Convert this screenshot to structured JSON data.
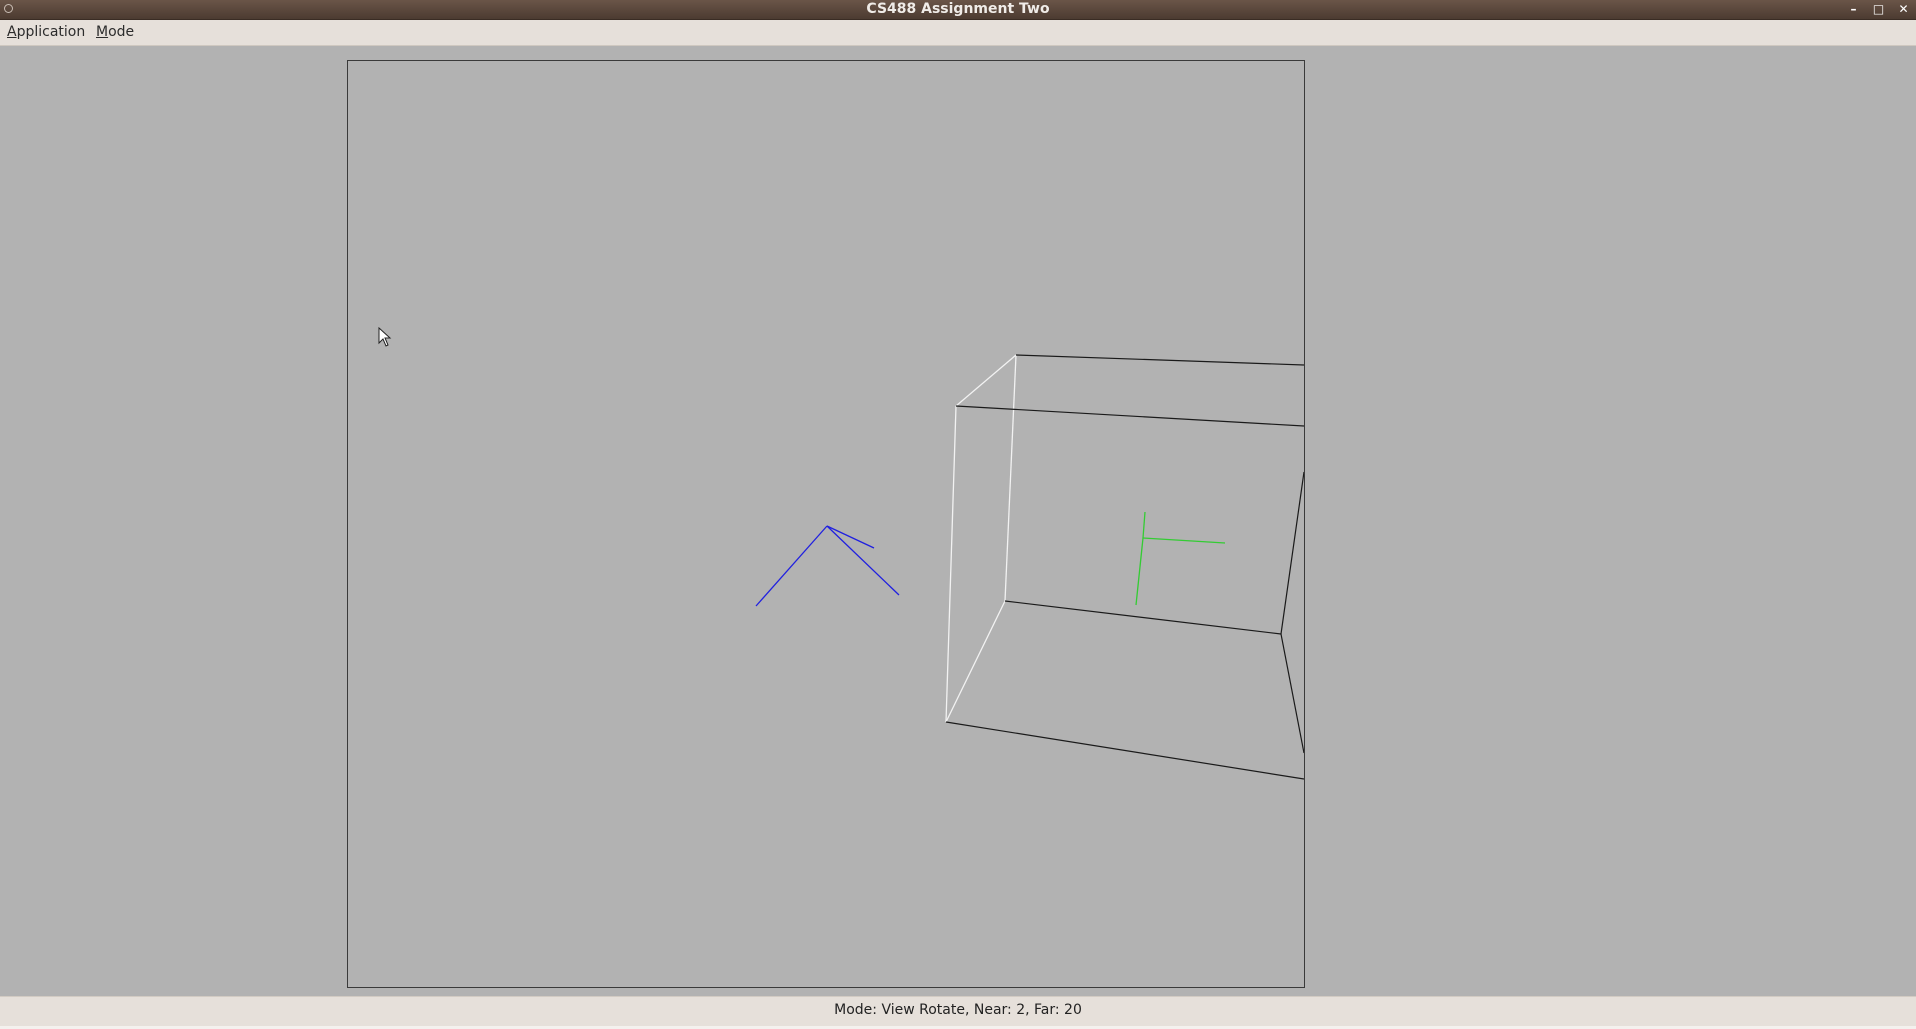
{
  "window": {
    "title": "CS488 Assignment Two",
    "controls": {
      "minimize": "–",
      "maximize": "□",
      "close": "✕"
    }
  },
  "menubar": {
    "items": [
      {
        "label_mnemonic": "A",
        "label_rest": "pplication"
      },
      {
        "label_mnemonic": "M",
        "label_rest": "ode"
      }
    ]
  },
  "viewport": {
    "background": "#b2b2b2",
    "colors": {
      "box_front": "#f2f2f2",
      "box_back": "#1a1a1a",
      "model_gnomon": "#2020e0",
      "world_gnomon": "#33cc33"
    }
  },
  "status": {
    "text": "Mode: View Rotate, Near: 2, Far: 20"
  }
}
